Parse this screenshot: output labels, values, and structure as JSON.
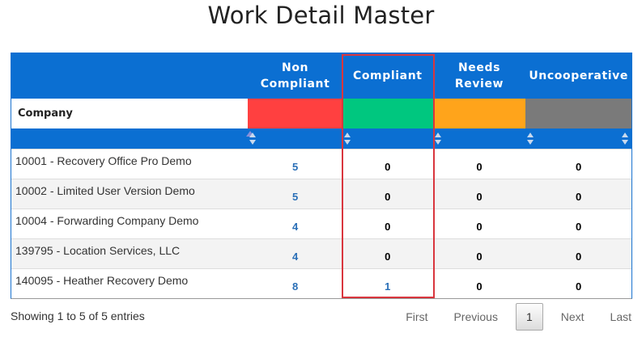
{
  "page": {
    "title": "Work Detail Master"
  },
  "table": {
    "columns": [
      {
        "line1": "",
        "line2": ""
      },
      {
        "line1": "Non",
        "line2": "Compliant"
      },
      {
        "line1": "Compliant",
        "line2": ""
      },
      {
        "line1": "Needs",
        "line2": "Review"
      },
      {
        "line1": "Uncooperative",
        "line2": ""
      }
    ],
    "company_label": "Company",
    "status_colors": {
      "non_compliant": "#ff4040",
      "compliant": "#00c77f",
      "needs_review": "#ffa41b",
      "uncooperative": "#7a7a7a"
    },
    "header_color": "#0b6fd2",
    "rows": [
      {
        "company": "10001 - Recovery Office Pro Demo",
        "non_compliant": "5",
        "compliant": "0",
        "needs_review": "0",
        "uncooperative": "0"
      },
      {
        "company": "10002 - Limited User Version Demo",
        "non_compliant": "5",
        "compliant": "0",
        "needs_review": "0",
        "uncooperative": "0"
      },
      {
        "company": "10004 - Forwarding Company Demo",
        "non_compliant": "4",
        "compliant": "0",
        "needs_review": "0",
        "uncooperative": "0"
      },
      {
        "company": "139795 - Location Services, LLC",
        "non_compliant": "4",
        "compliant": "0",
        "needs_review": "0",
        "uncooperative": "0"
      },
      {
        "company": "140095 - Heather Recovery Demo",
        "non_compliant": "8",
        "compliant": "1",
        "needs_review": "0",
        "uncooperative": "0"
      }
    ]
  },
  "footer": {
    "info": "Showing 1 to 5 of 5 entries",
    "pagination": {
      "first": "First",
      "previous": "Previous",
      "current": "1",
      "next": "Next",
      "last": "Last"
    }
  }
}
